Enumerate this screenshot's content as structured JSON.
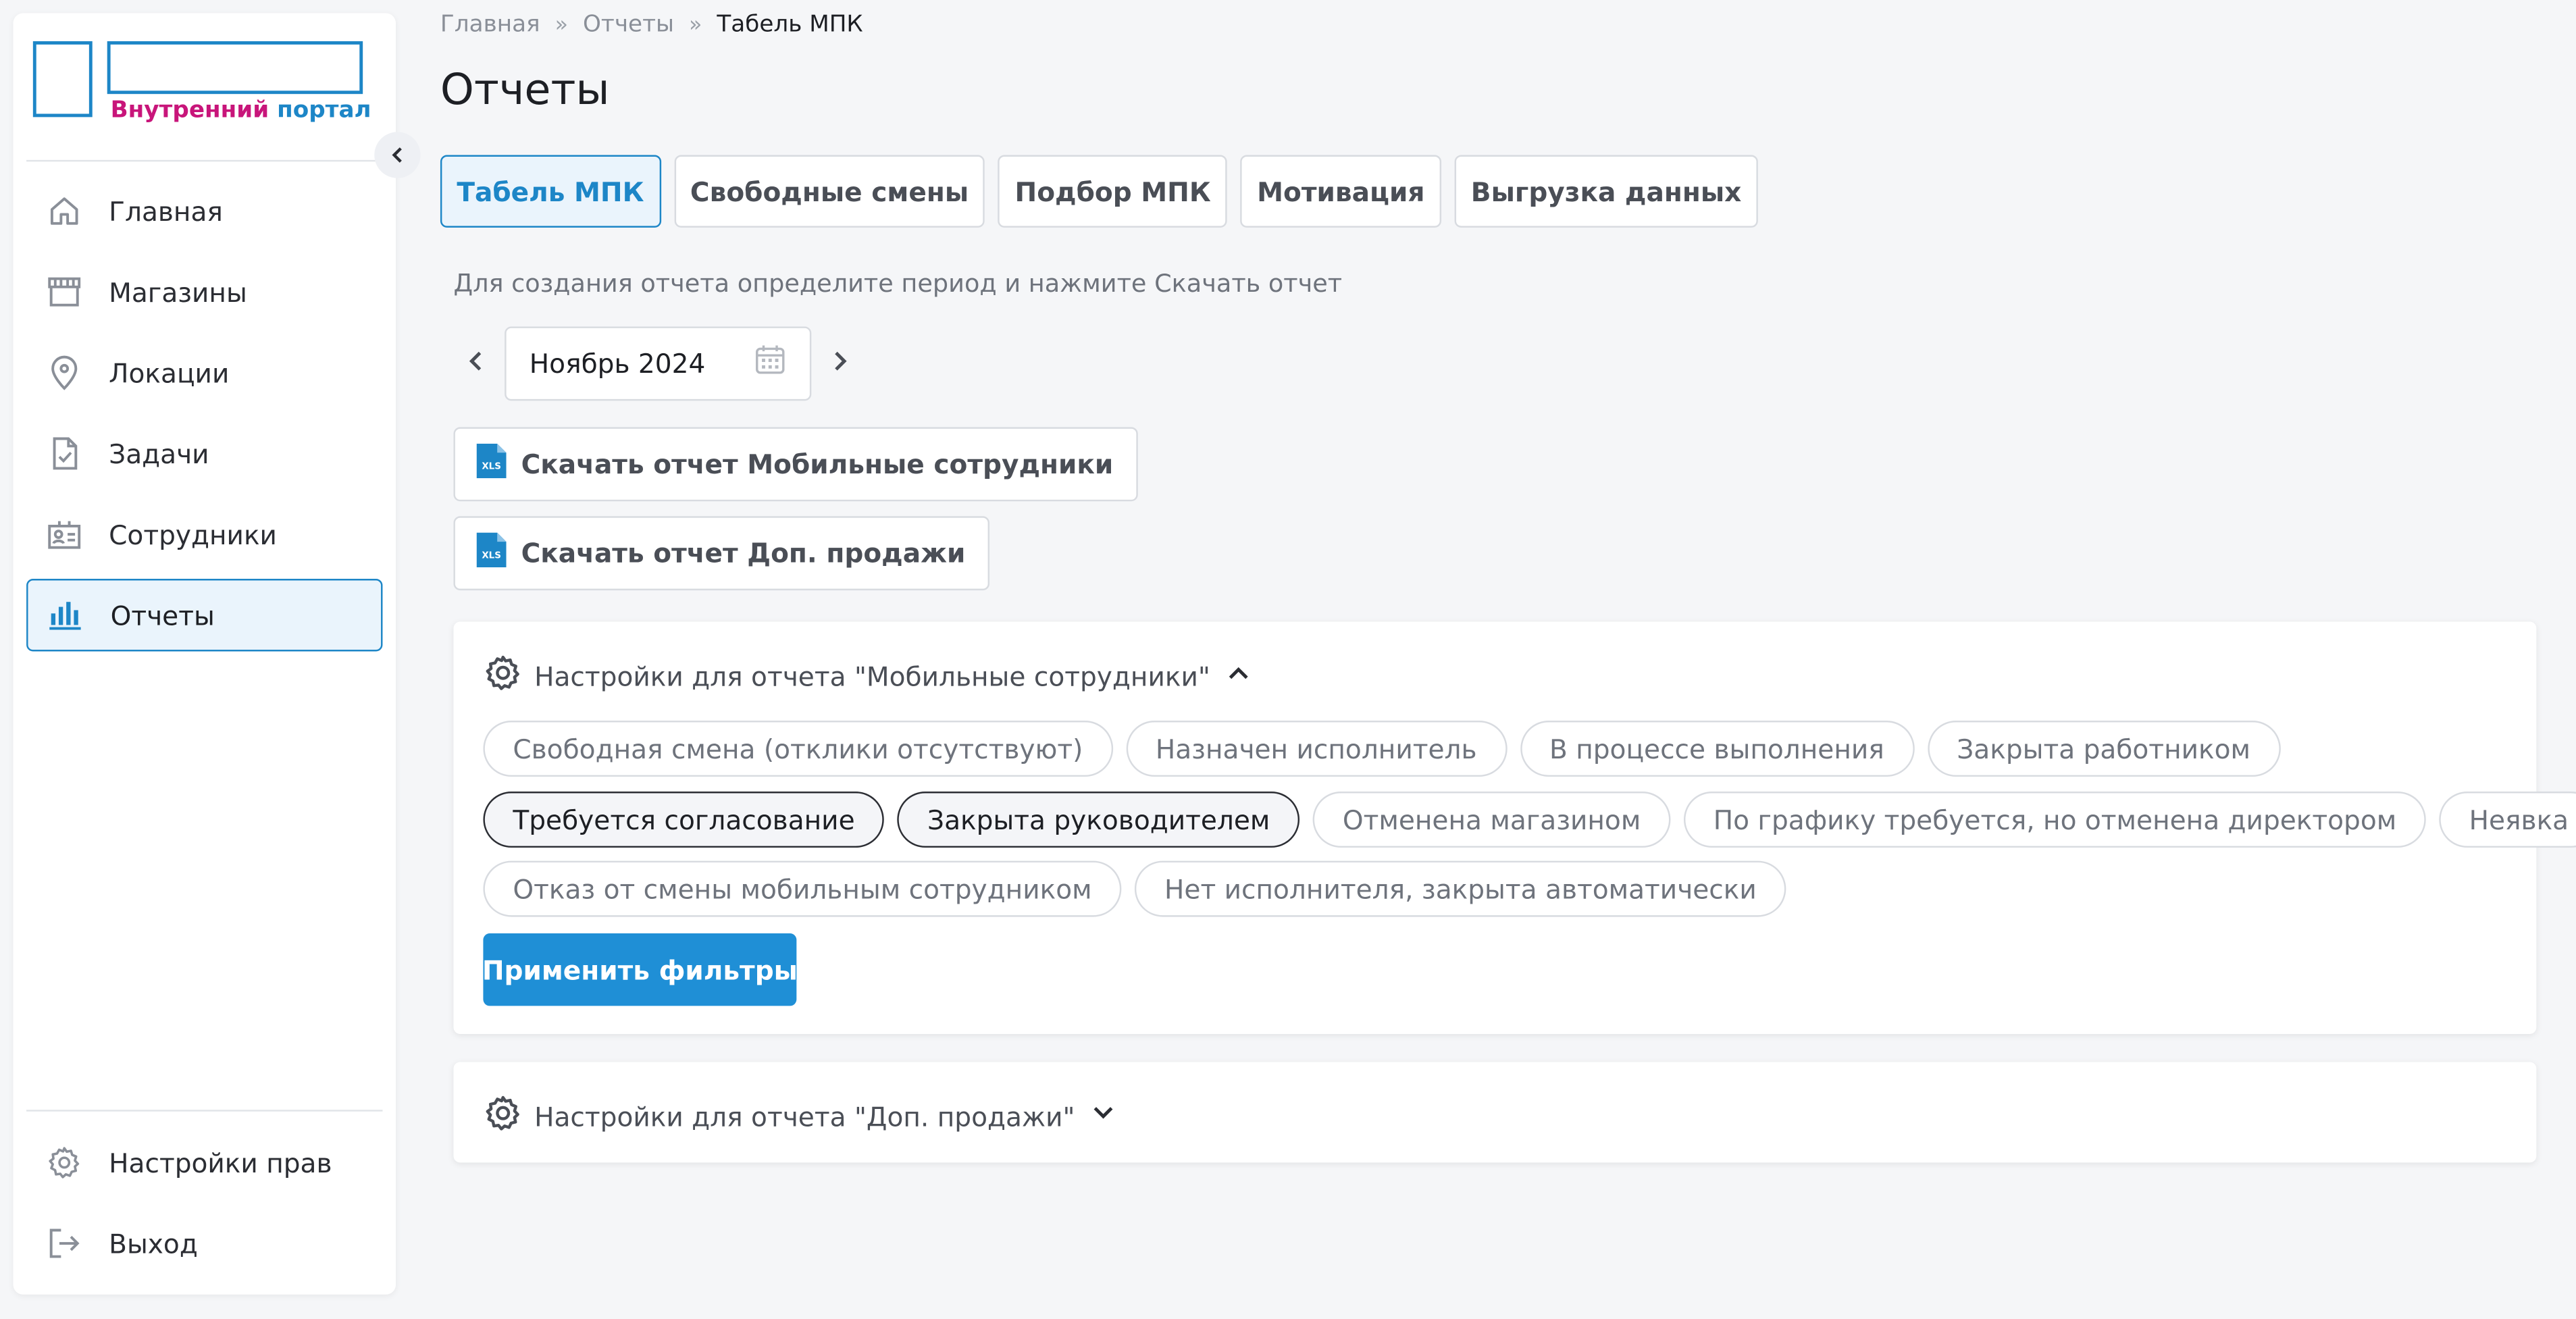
{
  "logo": {
    "part1": "Внутренний",
    "part2": "портал",
    "color1": "#c8157a",
    "color2": "#1d86c7"
  },
  "sidebar": {
    "items": [
      {
        "label": "Главная",
        "icon": "home-icon"
      },
      {
        "label": "Магазины",
        "icon": "store-icon"
      },
      {
        "label": "Локации",
        "icon": "location-pin-icon"
      },
      {
        "label": "Задачи",
        "icon": "task-checklist-icon"
      },
      {
        "label": "Сотрудники",
        "icon": "employee-badge-icon"
      },
      {
        "label": "Отчеты",
        "icon": "bar-chart-icon",
        "active": true
      }
    ],
    "bottom": [
      {
        "label": "Настройки прав",
        "icon": "gear-icon"
      },
      {
        "label": "Выход",
        "icon": "logout-icon"
      }
    ]
  },
  "breadcrumb": {
    "items": [
      "Главная",
      "Отчеты"
    ],
    "current": "Табель МПК"
  },
  "page": {
    "title": "Отчеты"
  },
  "tabs": [
    {
      "label": "Табель МПК",
      "active": true
    },
    {
      "label": "Свободные смены"
    },
    {
      "label": "Подбор МПК"
    },
    {
      "label": "Мотивация"
    },
    {
      "label": "Выгрузка данных"
    }
  ],
  "hint": "Для создания отчета определите период и нажмите Скачать отчет",
  "period": {
    "value": "Ноябрь 2024"
  },
  "downloads": [
    {
      "label": "Скачать отчет Мобильные сотрудники",
      "icon": "xls-file-icon"
    },
    {
      "label": "Скачать отчет Доп. продажи",
      "icon": "xls-file-icon"
    }
  ],
  "mobile_settings": {
    "title": "Настройки для отчета \"Мобильные сотрудники\"",
    "expanded": true,
    "chips": [
      [
        {
          "label": "Свободная смена (отклики отсутствуют)",
          "selected": false
        },
        {
          "label": "Назначен исполнитель",
          "selected": false
        },
        {
          "label": "В процессе выполнения",
          "selected": false
        },
        {
          "label": "Закрыта работником",
          "selected": false
        }
      ],
      [
        {
          "label": "Требуется согласование",
          "selected": true
        },
        {
          "label": "Закрыта руководителем",
          "selected": true
        },
        {
          "label": "Отменена магазином",
          "selected": false
        },
        {
          "label": "По графику требуется, но отменена директором",
          "selected": false
        },
        {
          "label": "Неявка",
          "selected": false
        }
      ],
      [
        {
          "label": "Отказ от смены мобильным сотрудником",
          "selected": false
        },
        {
          "label": "Нет исполнителя, закрыта автоматически",
          "selected": false
        }
      ]
    ],
    "apply_label": "Применить фильтры"
  },
  "sales_settings": {
    "title": "Настройки для отчета \"Доп. продажи\"",
    "expanded": false
  },
  "colors": {
    "accent": "#1d86c7",
    "apply_button": "#1f8fd6",
    "active_bg": "#eaf4fc"
  }
}
